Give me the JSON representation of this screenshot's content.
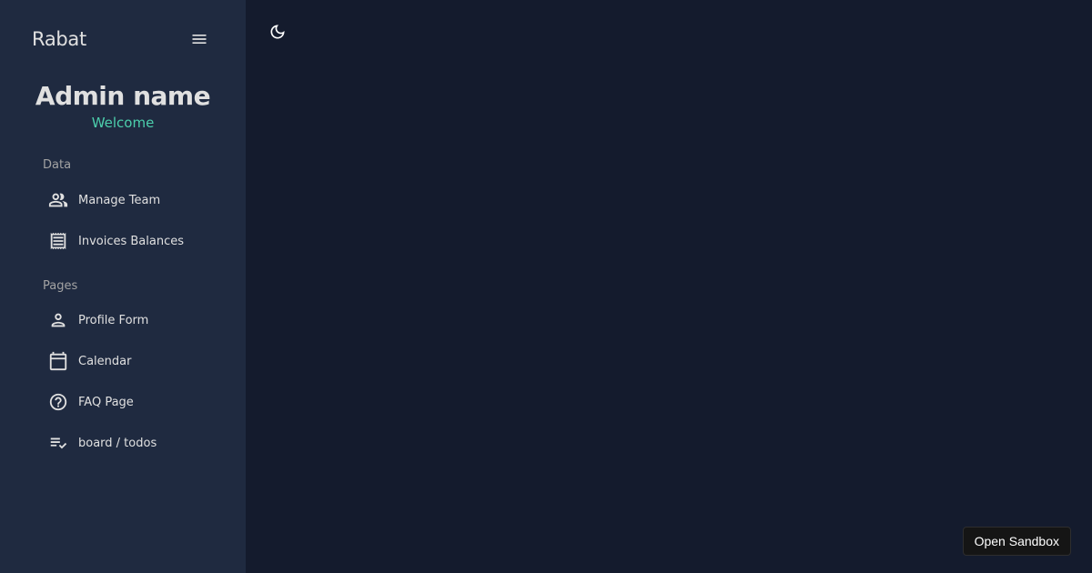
{
  "sidebar": {
    "brand": "Rabat",
    "menu_icon": "hamburger-menu-icon",
    "admin_name": "Admin name",
    "welcome": "Welcome",
    "sections": [
      {
        "label": "Data",
        "items": [
          {
            "label": "Manage Team",
            "icon": "people-icon"
          },
          {
            "label": "Invoices Balances",
            "icon": "receipt-icon"
          }
        ]
      },
      {
        "label": "Pages",
        "items": [
          {
            "label": "Profile Form",
            "icon": "person-icon"
          },
          {
            "label": "Calendar",
            "icon": "calendar-icon"
          },
          {
            "label": "FAQ Page",
            "icon": "help-circle-icon"
          },
          {
            "label": "board / todos",
            "icon": "playlist-check-icon"
          }
        ]
      }
    ]
  },
  "topbar": {
    "theme_toggle_icon": "moon-icon"
  },
  "footer": {
    "sandbox_button": "Open Sandbox"
  },
  "colors": {
    "background": "#141b2d",
    "sidebar": "#1f2a40",
    "accent": "#4cceac",
    "text": "#e0e0e0",
    "muted": "#a3a3a3"
  }
}
